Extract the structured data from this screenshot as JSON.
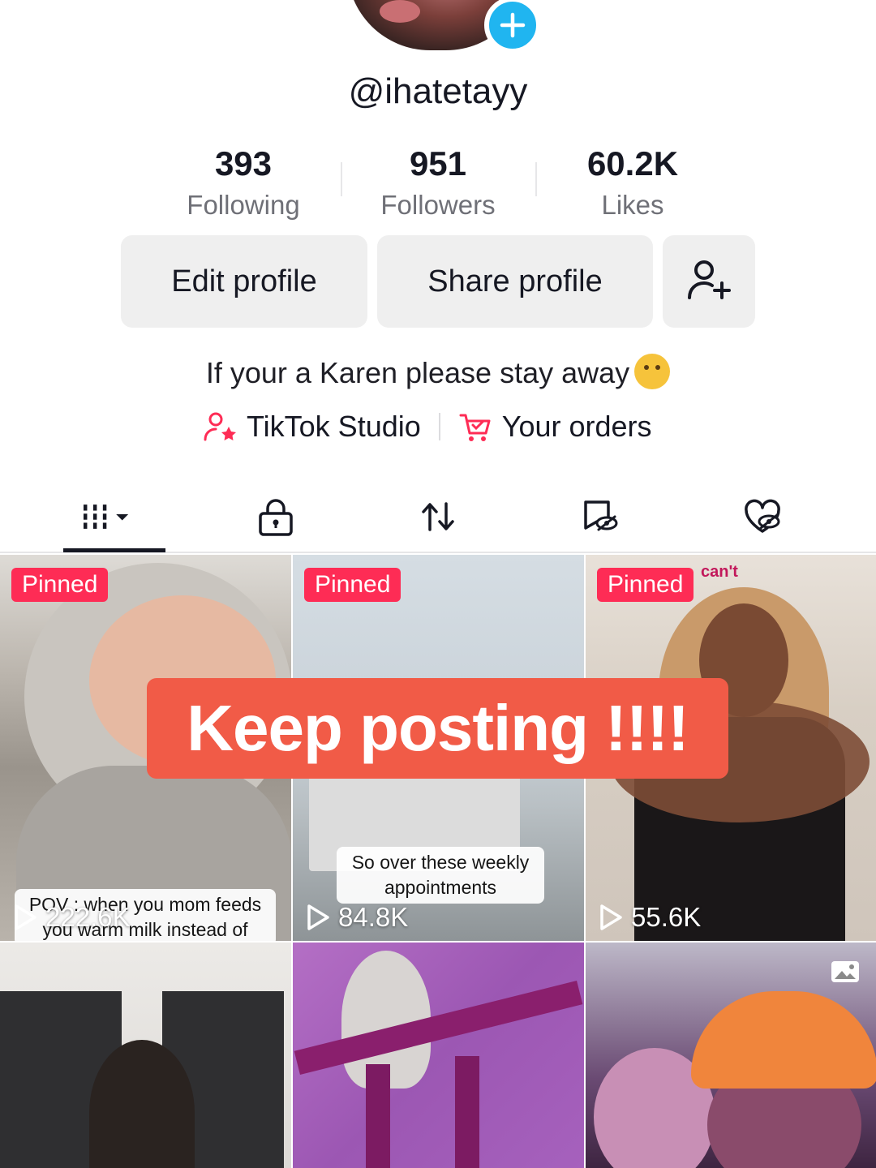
{
  "profile": {
    "username": "@ihatetayy",
    "stats": [
      {
        "value": "393",
        "label": "Following"
      },
      {
        "value": "951",
        "label": "Followers"
      },
      {
        "value": "60.2K",
        "label": "Likes"
      }
    ],
    "bio": "If your a Karen please stay away"
  },
  "buttons": {
    "edit": "Edit profile",
    "share": "Share profile"
  },
  "links": {
    "studio": "TikTok Studio",
    "orders": "Your orders"
  },
  "tabs": [
    {
      "icon": "grid-icon",
      "active": true
    },
    {
      "icon": "lock-icon"
    },
    {
      "icon": "repost-icon"
    },
    {
      "icon": "saved-icon"
    },
    {
      "icon": "liked-icon"
    }
  ],
  "videos": [
    {
      "pinned": "Pinned",
      "views": "222.6K",
      "caption": "POV : when you mom feeds you warm milk instead of"
    },
    {
      "pinned": "Pinned",
      "views": "84.8K",
      "caption": "So over these weekly appointments"
    },
    {
      "pinned": "Pinned",
      "views": "55.6K",
      "overlay_text": "can't"
    },
    {},
    {},
    {
      "icon": "photo-icon"
    }
  ],
  "toast": "Keep posting !!!!",
  "colors": {
    "accent": "#fe2c55",
    "toast": "#f15b47",
    "badge": "#20b5f0"
  }
}
